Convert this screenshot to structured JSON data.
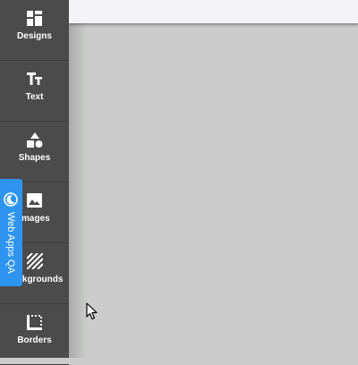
{
  "sidebar": {
    "items": [
      {
        "label": "Designs",
        "icon": "grid-icon"
      },
      {
        "label": "Text",
        "icon": "text-icon"
      },
      {
        "label": "Shapes",
        "icon": "shapes-icon"
      },
      {
        "label": "Images",
        "icon": "image-icon"
      },
      {
        "label": "Backgrounds",
        "icon": "background-pattern-icon"
      },
      {
        "label": "Borders",
        "icon": "border-icon"
      }
    ]
  },
  "qa_tab": {
    "label": "Web Apps QA",
    "icon": "moon-icon"
  },
  "colors": {
    "sidebar": "#4b4b4b",
    "canvas": "#cbcccb",
    "topbar": "#f3f3f5",
    "qa_tab": "#2d95ef"
  }
}
